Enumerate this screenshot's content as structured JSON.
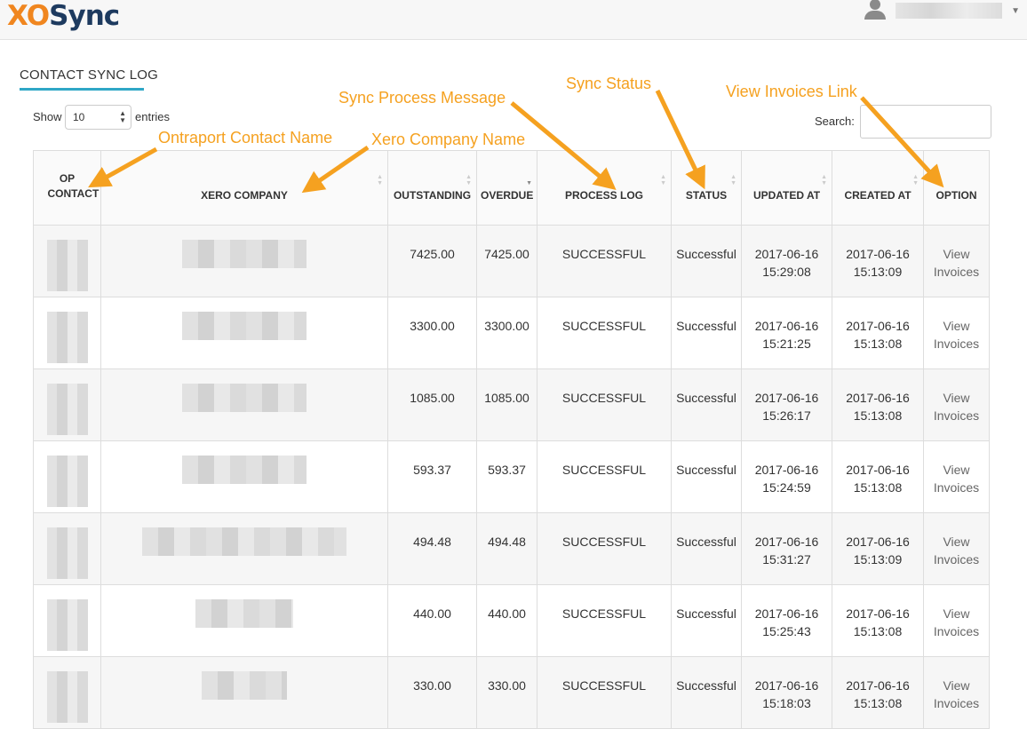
{
  "brand": {
    "logo_prefix": "XO",
    "logo_suffix": "Sync"
  },
  "header": {
    "user_icon": "user-icon",
    "dropdown_icon": "caret-down-icon"
  },
  "page": {
    "title": "CONTACT SYNC LOG"
  },
  "controls": {
    "show_label": "Show",
    "entries_value": "10",
    "entries_label": "entries",
    "search_label": "Search:"
  },
  "table": {
    "columns": [
      "OP CONTACT",
      "XERO COMPANY",
      "OUTSTANDING",
      "OVERDUE",
      "PROCESS LOG",
      "STATUS",
      "UPDATED AT",
      "CREATED AT",
      "OPTION"
    ],
    "rows": [
      {
        "outstanding": "7425.00",
        "overdue": "7425.00",
        "process_log": "SUCCESSFUL",
        "status": "Successful",
        "updated_date": "2017-06-16",
        "updated_time": "15:29:08",
        "created_date": "2017-06-16",
        "created_time": "15:13:09",
        "option_line1": "View",
        "option_line2": "Invoices"
      },
      {
        "outstanding": "3300.00",
        "overdue": "3300.00",
        "process_log": "SUCCESSFUL",
        "status": "Successful",
        "updated_date": "2017-06-16",
        "updated_time": "15:21:25",
        "created_date": "2017-06-16",
        "created_time": "15:13:08",
        "option_line1": "View",
        "option_line2": "Invoices"
      },
      {
        "outstanding": "1085.00",
        "overdue": "1085.00",
        "process_log": "SUCCESSFUL",
        "status": "Successful",
        "updated_date": "2017-06-16",
        "updated_time": "15:26:17",
        "created_date": "2017-06-16",
        "created_time": "15:13:08",
        "option_line1": "View",
        "option_line2": "Invoices"
      },
      {
        "outstanding": "593.37",
        "overdue": "593.37",
        "process_log": "SUCCESSFUL",
        "status": "Successful",
        "updated_date": "2017-06-16",
        "updated_time": "15:24:59",
        "created_date": "2017-06-16",
        "created_time": "15:13:08",
        "option_line1": "View",
        "option_line2": "Invoices"
      },
      {
        "outstanding": "494.48",
        "overdue": "494.48",
        "process_log": "SUCCESSFUL",
        "status": "Successful",
        "updated_date": "2017-06-16",
        "updated_time": "15:31:27",
        "created_date": "2017-06-16",
        "created_time": "15:13:09",
        "option_line1": "View",
        "option_line2": "Invoices"
      },
      {
        "outstanding": "440.00",
        "overdue": "440.00",
        "process_log": "SUCCESSFUL",
        "status": "Successful",
        "updated_date": "2017-06-16",
        "updated_time": "15:25:43",
        "created_date": "2017-06-16",
        "created_time": "15:13:08",
        "option_line1": "View",
        "option_line2": "Invoices"
      },
      {
        "outstanding": "330.00",
        "overdue": "330.00",
        "process_log": "SUCCESSFUL",
        "status": "Successful",
        "updated_date": "2017-06-16",
        "updated_time": "15:18:03",
        "created_date": "2017-06-16",
        "created_time": "15:13:08",
        "option_line1": "View",
        "option_line2": "Invoices"
      }
    ]
  },
  "annotations": {
    "op_contact": "Ontraport Contact Name",
    "xero_company": "Xero Company Name",
    "process_message": "Sync Process Message",
    "sync_status": "Sync Status",
    "view_invoices": "View Invoices Link"
  },
  "colors": {
    "accent": "#2fa7c6",
    "annotation": "#f5a120",
    "logo_orange": "#f0861f",
    "logo_navy": "#1d3a5f"
  }
}
